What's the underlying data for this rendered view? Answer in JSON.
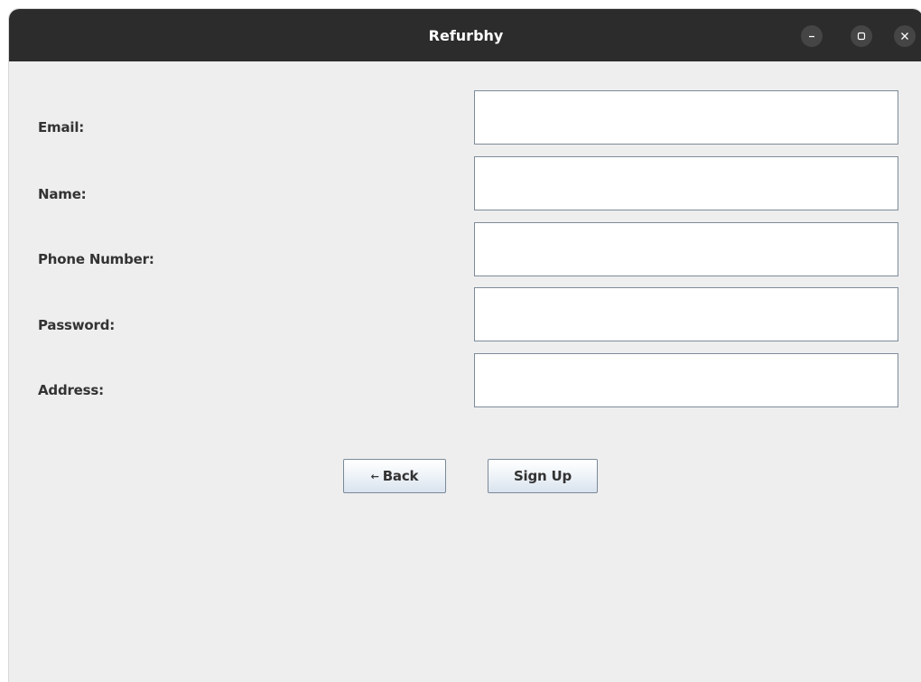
{
  "window": {
    "title": "Refurbhy",
    "controls": {
      "minimize_icon": "minimize-icon",
      "maximize_icon": "maximize-icon",
      "close_icon": "close-icon"
    }
  },
  "form": {
    "fields": [
      {
        "label": "Email:",
        "value": ""
      },
      {
        "label": "Name:",
        "value": ""
      },
      {
        "label": "Phone Number:",
        "value": ""
      },
      {
        "label": "Password:",
        "value": ""
      },
      {
        "label": "Address:",
        "value": ""
      }
    ],
    "back_arrow": "←",
    "back_label": "Back",
    "signup_label": "Sign Up"
  },
  "colors": {
    "titlebar": "#2c2c2c",
    "background": "#eeeeee",
    "field_border": "#7d8b9a"
  }
}
